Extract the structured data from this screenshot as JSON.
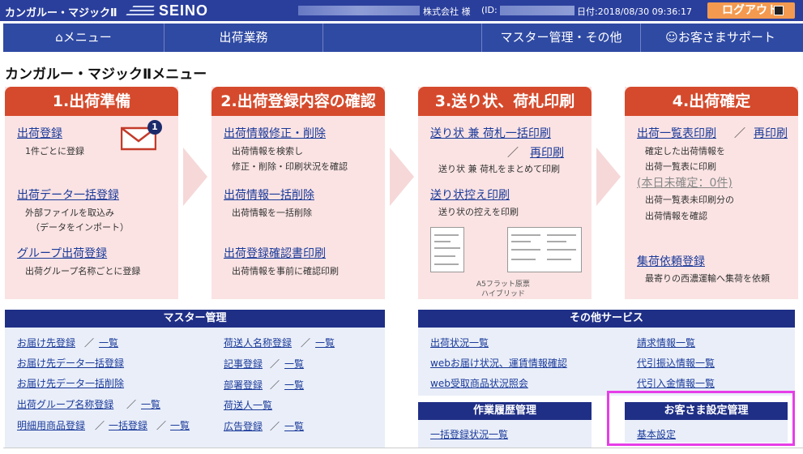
{
  "topbar": {
    "brand": "カンガルー・マジックⅡ",
    "logo_text": "SEINO",
    "company": "株式会社 様",
    "id_label": "(ID:",
    "date": "日付:2018/08/30 09:36:17",
    "logout": "ログアウト"
  },
  "nav": {
    "menu": "メニュー",
    "shipping": "出荷業務",
    "master": "マスター管理・その他",
    "support": "お客さまサポート"
  },
  "page_title": "カンガルー・マジックⅡメニュー",
  "steps": [
    {
      "title": "1.出荷準備",
      "links": [
        {
          "label": "出荷登録",
          "desc": [
            "1件ごとに登録"
          ]
        },
        {
          "label": "出荷データ一括登録",
          "desc": [
            "外部ファイルを取込み",
            "（データをインポート）"
          ]
        },
        {
          "label": "グループ出荷登録",
          "desc": [
            "出荷グループ名称ごとに登録"
          ]
        }
      ],
      "badge": "1"
    },
    {
      "title": "2.出荷登録内容の確認",
      "links": [
        {
          "label": "出荷情報修正・削除",
          "desc": [
            "出荷情報を検索し",
            "修正・削除・印刷状況を確認"
          ]
        },
        {
          "label": "出荷情報一括削除",
          "desc": [
            "出荷情報を一括削除"
          ]
        },
        {
          "label": "出荷登録確認書印刷",
          "desc": [
            "出荷情報を事前に確認印刷"
          ]
        }
      ]
    },
    {
      "title": "3.送り状、荷札印刷",
      "links": [
        {
          "label": "送り状 兼 荷札一括印刷",
          "sep": "／",
          "reprint": "再印刷",
          "desc": [
            "送り状 兼 荷札をまとめて印刷"
          ]
        },
        {
          "label": "送り状控え印刷",
          "desc": [
            "送り状の控えを印刷"
          ]
        }
      ],
      "caption": [
        "A5フラット原票",
        "ハイブリッド"
      ]
    },
    {
      "title": "4.出荷確定",
      "links": [
        {
          "label": "出荷一覧表印刷",
          "sep": "／",
          "reprint": "再印刷",
          "desc": [
            "確定した出荷情報を",
            "出荷一覧表に印刷"
          ]
        },
        {
          "label": "集荷依頼登録",
          "desc": [
            "最寄りの西濃運輸へ集荷を依頼"
          ]
        }
      ],
      "unconfirmed": "(本日未確定：0件)",
      "desc2": [
        "出荷一覧表未印刷分の",
        "出荷情報を確認"
      ]
    }
  ],
  "master": {
    "title": "マスター管理",
    "left": [
      {
        "a": "お届け先登録",
        "b": "一覧"
      },
      {
        "a": "お届け先データ一括登録"
      },
      {
        "a": "お届け先データ一括削除"
      },
      {
        "a": "出荷グループ名称登録",
        "b": "一覧"
      },
      {
        "a": "明細用商品登録",
        "b": "一括登録",
        "c": "一覧"
      }
    ],
    "right": [
      {
        "a": "荷送人名称登録",
        "b": "一覧"
      },
      {
        "a": "記事登録",
        "b": "一覧"
      },
      {
        "a": "部署登録",
        "b": "一覧"
      },
      {
        "a": "荷送人一覧"
      },
      {
        "a": "広告登録",
        "b": "一覧"
      }
    ],
    "sep": "／"
  },
  "other": {
    "title": "その他サービス",
    "left": [
      "出荷状況一覧",
      "webお届け状況、運賃情報確認",
      "web受取商品状況照会"
    ],
    "right": [
      "請求情報一覧",
      "代引振込情報一覧",
      "代引入金情報一覧"
    ]
  },
  "history": {
    "title": "作業履歴管理",
    "items": [
      "一括登録状況一覧"
    ]
  },
  "settings": {
    "title": "お客さま設定管理",
    "items": [
      "基本設定"
    ]
  },
  "colors": {
    "topbar": "#2a3f9c",
    "nav": "#2f4aa3",
    "step_header": "#d54a2c",
    "step_bg": "#fbe3e3",
    "panel_header": "#1f2f86",
    "panel_bg": "#e9eef8",
    "highlight": "#e63ee8",
    "logout": "#f39a50"
  }
}
